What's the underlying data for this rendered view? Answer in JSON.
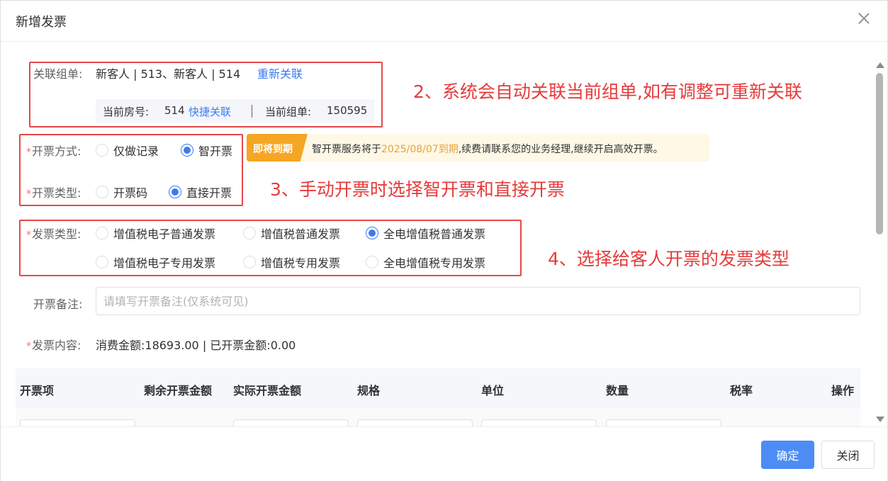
{
  "dialog": {
    "title": "新增发票"
  },
  "related_order": {
    "label": "关联组单:",
    "value": "新客人 | 513、新客人 | 514",
    "relink": "重新关联",
    "room_label": "当前房号:",
    "room_value": "514",
    "quick_link": "快捷关联",
    "order_label": "当前组单:",
    "order_value": "150595"
  },
  "invoice_method": {
    "label": "开票方式:",
    "options": [
      {
        "label": "仅做记录",
        "checked": false
      },
      {
        "label": "智开票",
        "checked": true
      }
    ]
  },
  "warning": {
    "tag": "即将到期",
    "text_before": "智开票服务将于",
    "date": "2025/08/07到期",
    "text_after": ",续费请联系您的业务经理,继续开启高效开票。"
  },
  "issue_type": {
    "label": "开票类型:",
    "options": [
      {
        "label": "开票码",
        "checked": false
      },
      {
        "label": "直接开票",
        "checked": true
      }
    ]
  },
  "invoice_type": {
    "label": "发票类型:",
    "options": [
      {
        "label": "增值税电子普通发票",
        "checked": false
      },
      {
        "label": "增值税普通发票",
        "checked": false
      },
      {
        "label": "全电增值税普通发票",
        "checked": true
      },
      {
        "label": "增值税电子专用发票",
        "checked": false
      },
      {
        "label": "增值税专用发票",
        "checked": false
      },
      {
        "label": "全电增值税专用发票",
        "checked": false
      }
    ]
  },
  "remark": {
    "label": "开票备注:",
    "placeholder": "请填写开票备注(仅系统可见)",
    "value": ""
  },
  "content": {
    "label": "发票内容:",
    "summary": "消费金额:18693.00 | 已开票金额:0.00"
  },
  "table": {
    "headers": [
      "开票项",
      "剩余开票金额",
      "实际开票金额",
      "规格",
      "单位",
      "数量",
      "税率",
      "操作"
    ]
  },
  "annotations": {
    "a2": "2、系统会自动关联当前组单,如有调整可重新关联",
    "a3": "3、手动开票时选择智开票和直接开票",
    "a4": "4、选择给客人开票的发票类型"
  },
  "footer": {
    "confirm": "确定",
    "close": "关闭"
  },
  "colors": {
    "primary": "#3a7bf0",
    "annotation": "#e53b3b",
    "warning": "#f5a623"
  }
}
